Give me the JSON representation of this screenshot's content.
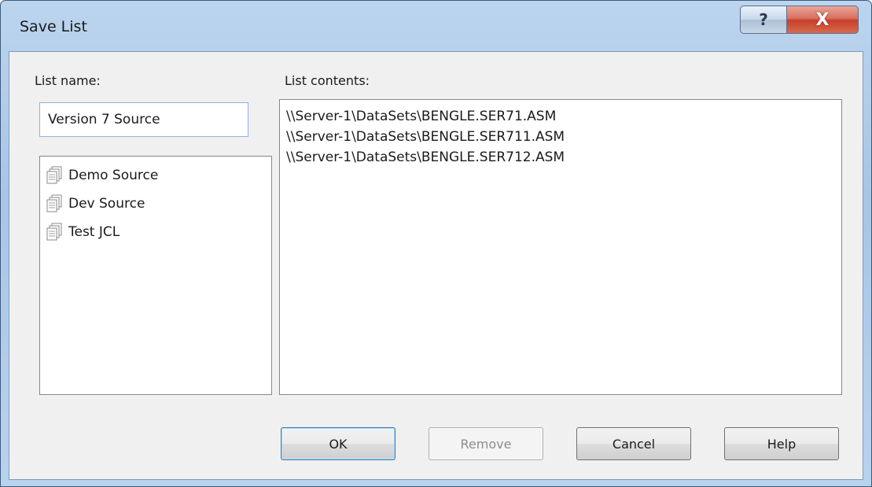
{
  "window": {
    "title": "Save List",
    "help_glyph": "?",
    "close_glyph": "X"
  },
  "list_name": {
    "label": "List name:",
    "value": "Version 7 Source"
  },
  "saved_lists": {
    "items": [
      {
        "label": "Demo Source",
        "icon": "document-stack-icon"
      },
      {
        "label": "Dev Source",
        "icon": "document-stack-icon"
      },
      {
        "label": "Test JCL",
        "icon": "document-stack-icon"
      }
    ]
  },
  "list_contents": {
    "label": "List contents:",
    "items": [
      "\\\\Server-1\\DataSets\\BENGLE.SER71.ASM",
      "\\\\Server-1\\DataSets\\BENGLE.SER711.ASM",
      "\\\\Server-1\\DataSets\\BENGLE.SER712.ASM"
    ]
  },
  "buttons": {
    "ok": "OK",
    "remove": "Remove",
    "cancel": "Cancel",
    "help": "Help"
  },
  "colors": {
    "title_bar": "#bcd4ee",
    "close_button": "#c7402a",
    "dialog_face": "#f0f0f0"
  }
}
